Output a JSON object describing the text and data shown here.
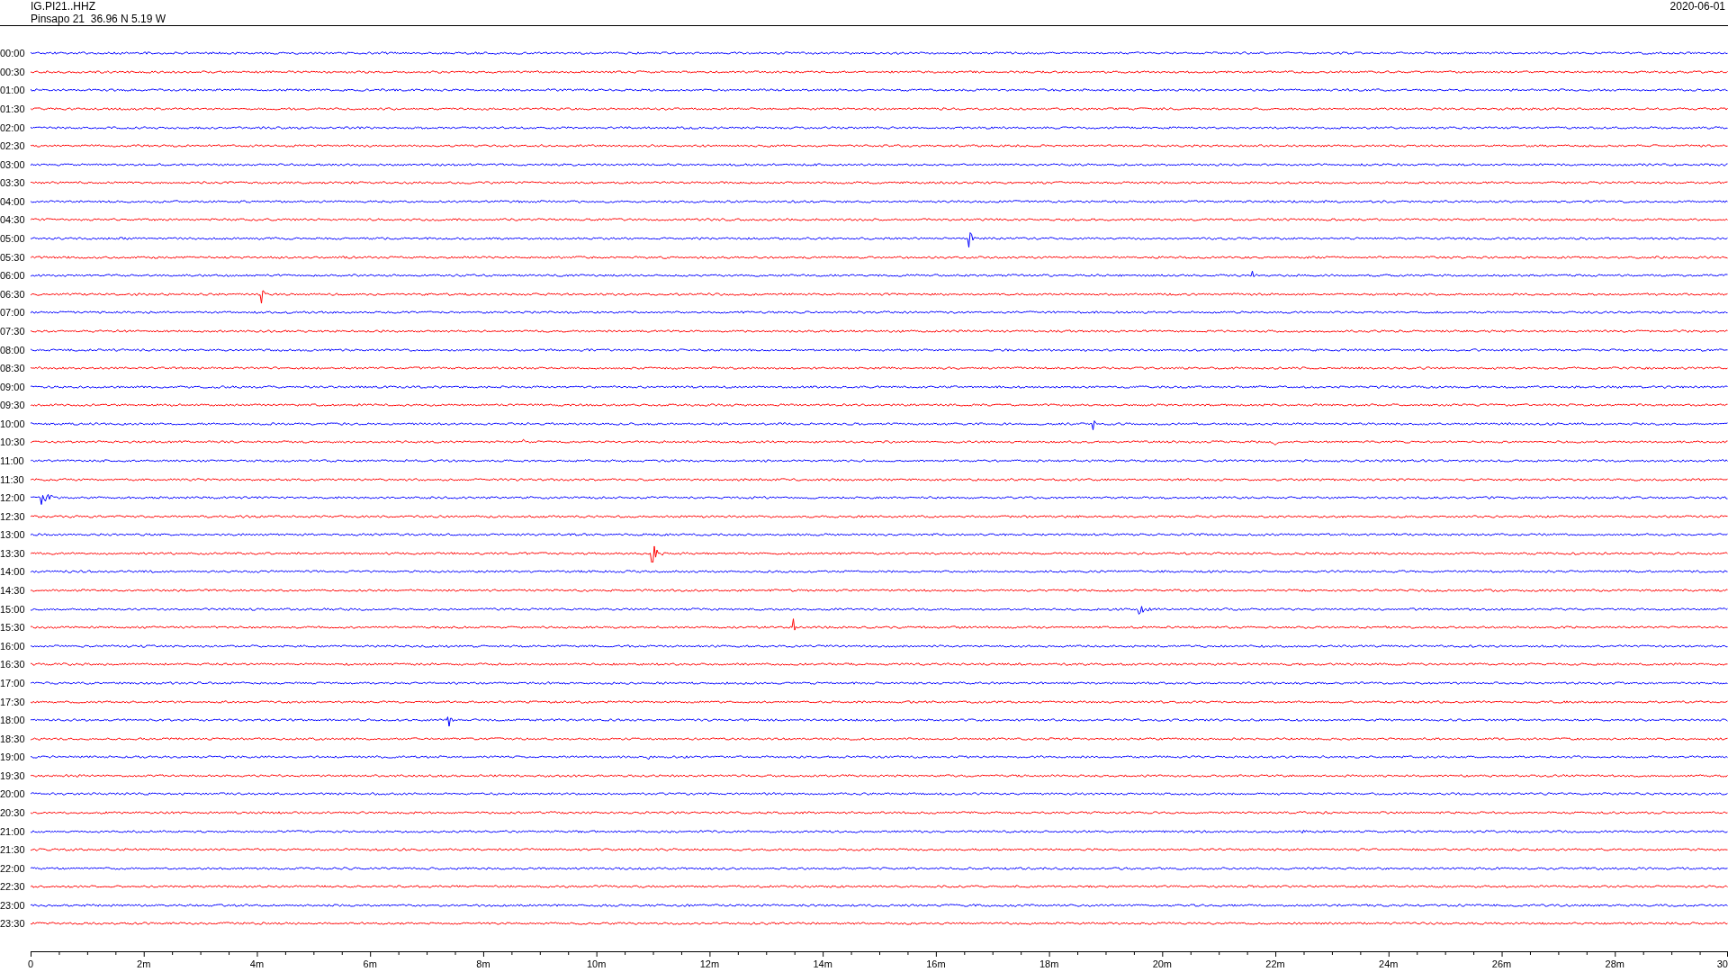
{
  "header": {
    "station": "IG.PI21..HHZ",
    "location": "Pinsapo 21  36.96 N 5.19 W",
    "date": "2020-06-01"
  },
  "rows": [
    {
      "label": "00:00",
      "color": "#0000ff"
    },
    {
      "label": "00:30",
      "color": "#ff0000"
    },
    {
      "label": "01:00",
      "color": "#0000ff"
    },
    {
      "label": "01:30",
      "color": "#ff0000"
    },
    {
      "label": "02:00",
      "color": "#0000ff"
    },
    {
      "label": "02:30",
      "color": "#ff0000"
    },
    {
      "label": "03:00",
      "color": "#0000ff"
    },
    {
      "label": "03:30",
      "color": "#ff0000"
    },
    {
      "label": "04:00",
      "color": "#0000ff"
    },
    {
      "label": "04:30",
      "color": "#ff0000"
    },
    {
      "label": "05:00",
      "color": "#0000ff"
    },
    {
      "label": "05:30",
      "color": "#ff0000"
    },
    {
      "label": "06:00",
      "color": "#0000ff"
    },
    {
      "label": "06:30",
      "color": "#ff0000"
    },
    {
      "label": "07:00",
      "color": "#0000ff"
    },
    {
      "label": "07:30",
      "color": "#ff0000"
    },
    {
      "label": "08:00",
      "color": "#0000ff"
    },
    {
      "label": "08:30",
      "color": "#ff0000"
    },
    {
      "label": "09:00",
      "color": "#0000ff"
    },
    {
      "label": "09:30",
      "color": "#ff0000"
    },
    {
      "label": "10:00",
      "color": "#0000ff"
    },
    {
      "label": "10:30",
      "color": "#ff0000"
    },
    {
      "label": "11:00",
      "color": "#0000ff"
    },
    {
      "label": "11:30",
      "color": "#ff0000"
    },
    {
      "label": "12:00",
      "color": "#0000ff"
    },
    {
      "label": "12:30",
      "color": "#ff0000"
    },
    {
      "label": "13:00",
      "color": "#0000ff"
    },
    {
      "label": "13:30",
      "color": "#ff0000"
    },
    {
      "label": "14:00",
      "color": "#0000ff"
    },
    {
      "label": "14:30",
      "color": "#ff0000"
    },
    {
      "label": "15:00",
      "color": "#0000ff"
    },
    {
      "label": "15:30",
      "color": "#ff0000"
    },
    {
      "label": "16:00",
      "color": "#0000ff"
    },
    {
      "label": "16:30",
      "color": "#ff0000"
    },
    {
      "label": "17:00",
      "color": "#0000ff"
    },
    {
      "label": "17:30",
      "color": "#ff0000"
    },
    {
      "label": "18:00",
      "color": "#0000ff"
    },
    {
      "label": "18:30",
      "color": "#ff0000"
    },
    {
      "label": "19:00",
      "color": "#0000ff"
    },
    {
      "label": "19:30",
      "color": "#ff0000"
    },
    {
      "label": "20:00",
      "color": "#0000ff"
    },
    {
      "label": "20:30",
      "color": "#ff0000"
    },
    {
      "label": "21:00",
      "color": "#0000ff"
    },
    {
      "label": "21:30",
      "color": "#ff0000"
    },
    {
      "label": "22:00",
      "color": "#0000ff"
    },
    {
      "label": "22:30",
      "color": "#ff0000"
    },
    {
      "label": "23:00",
      "color": "#0000ff"
    },
    {
      "label": "23:30",
      "color": "#ff0000"
    }
  ],
  "time_axis": {
    "ticks": [
      "0",
      "2m",
      "4m",
      "6m",
      "8m",
      "10m",
      "12m",
      "14m",
      "16m",
      "18m",
      "20m",
      "22m",
      "24m",
      "26m",
      "28m",
      "30"
    ]
  }
}
